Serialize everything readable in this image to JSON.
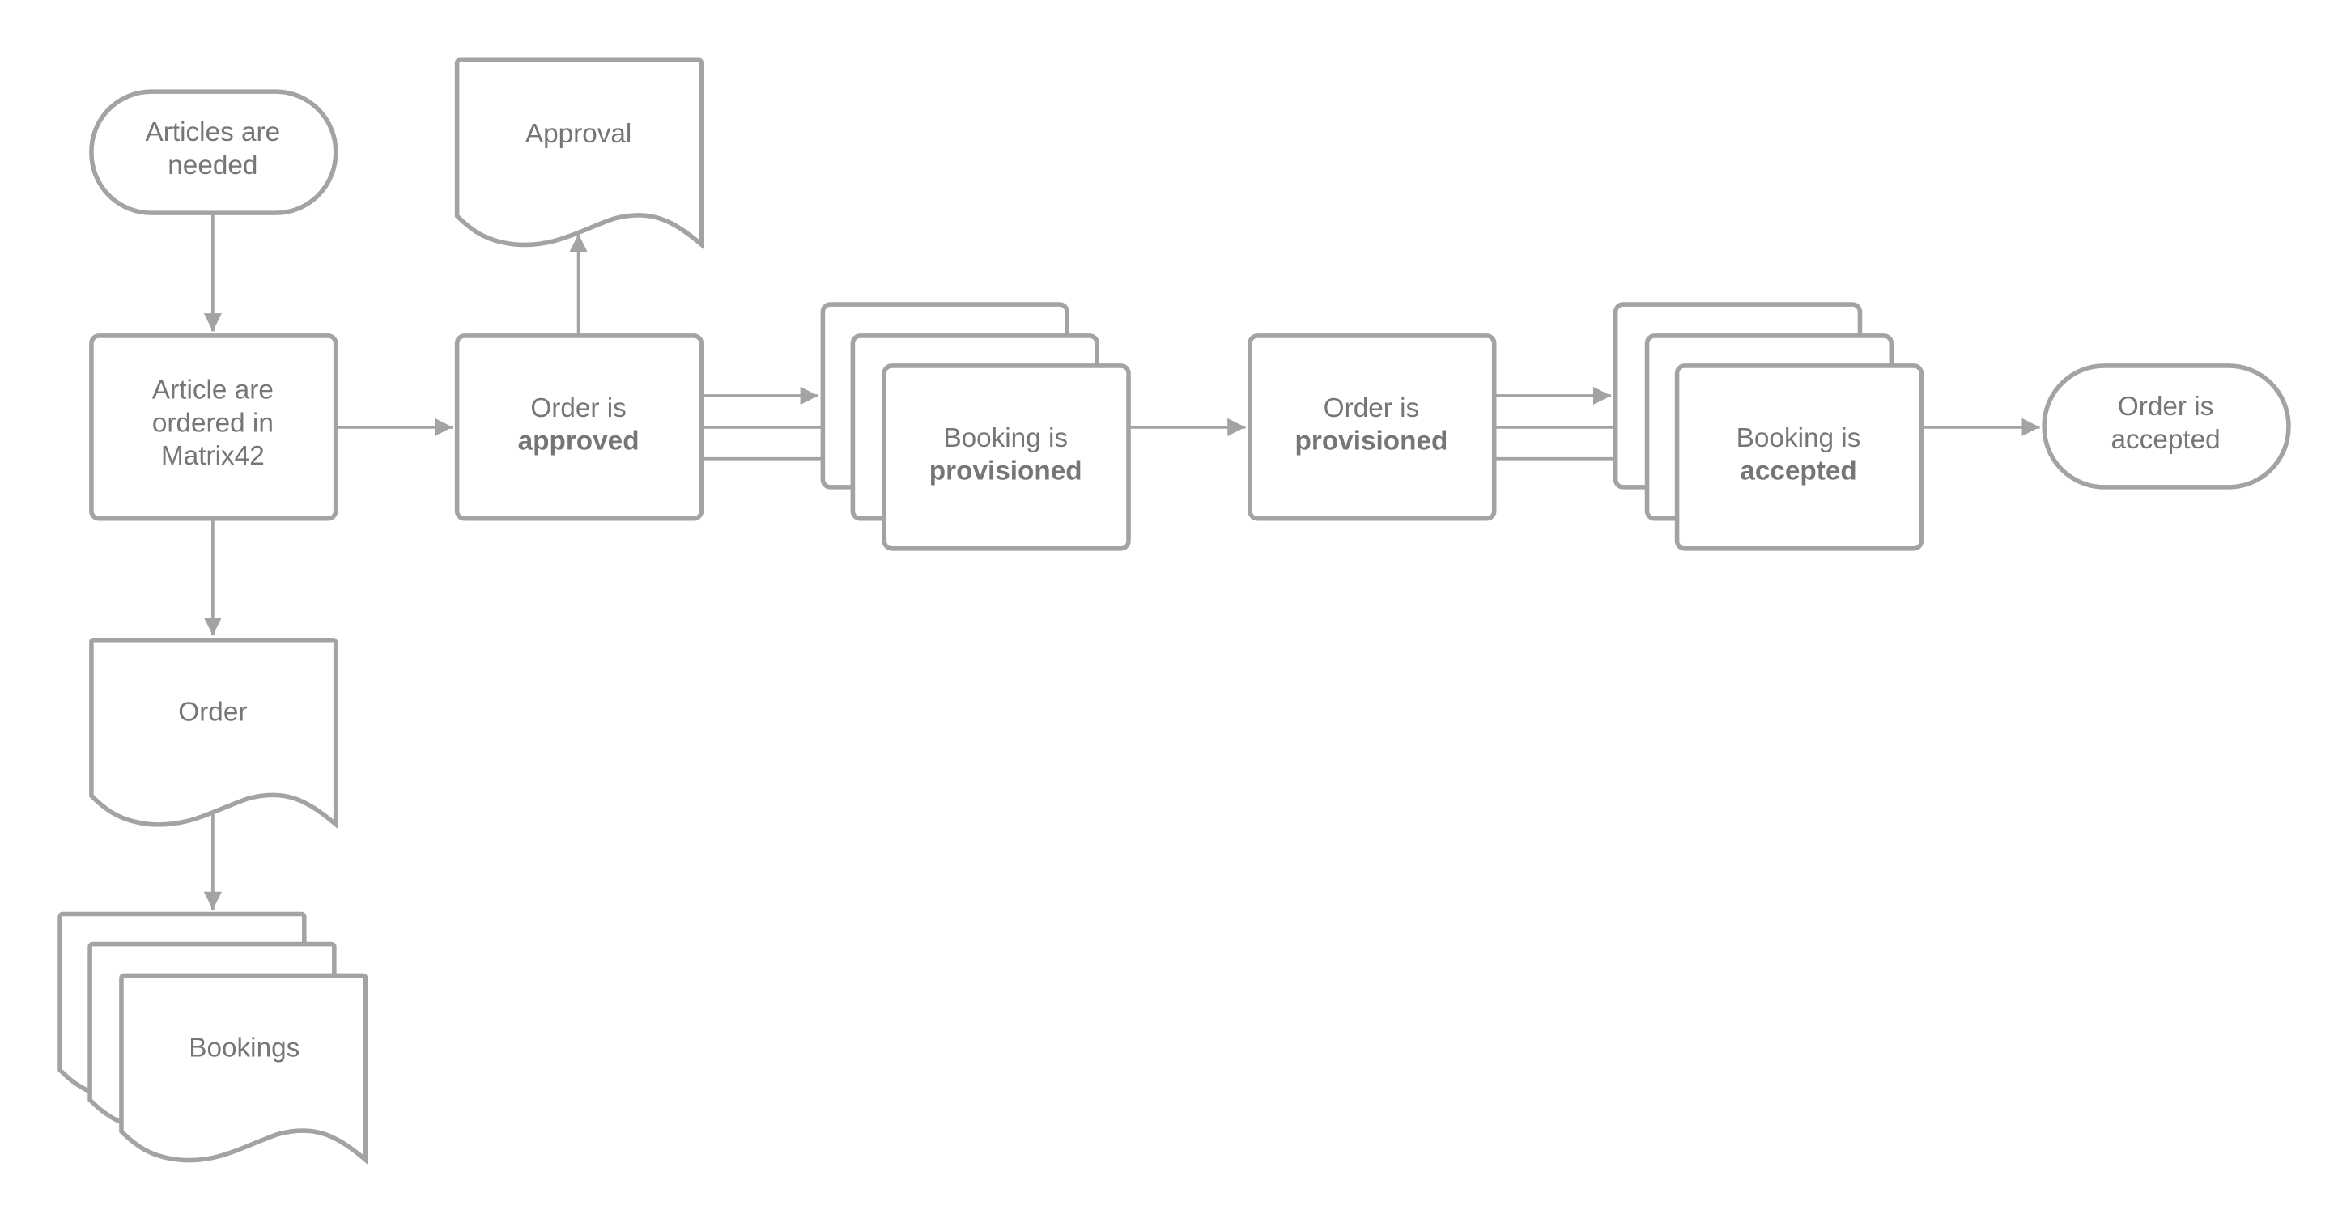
{
  "diagram": {
    "colors": {
      "stroke": "#a3a3a3",
      "text": "#767676",
      "background": "#ffffff"
    },
    "nodes": {
      "start": {
        "type": "terminator",
        "lines": [
          "Articles are",
          "needed"
        ]
      },
      "ordered": {
        "type": "process",
        "lines": [
          "Article are",
          "ordered in",
          "Matrix42"
        ]
      },
      "order_doc": {
        "type": "document",
        "lines": [
          "Order"
        ]
      },
      "bookings_doc": {
        "type": "multi-document",
        "lines": [
          "Bookings"
        ]
      },
      "approval_doc": {
        "type": "document",
        "lines": [
          "Approval"
        ]
      },
      "approved": {
        "type": "process",
        "line1": "Order is",
        "line2_bold": "approved"
      },
      "booking_provisioned": {
        "type": "multi-process",
        "line1": "Booking is",
        "line2_bold": "provisioned"
      },
      "order_provisioned": {
        "type": "process",
        "line1": "Order is",
        "line2_bold": "provisioned"
      },
      "booking_accepted": {
        "type": "multi-process",
        "line1": "Booking is",
        "line2_bold": "accepted"
      },
      "end": {
        "type": "terminator",
        "lines": [
          "Order is",
          "accepted"
        ]
      }
    },
    "edges": [
      [
        "start",
        "ordered"
      ],
      [
        "ordered",
        "order_doc"
      ],
      [
        "order_doc",
        "bookings_doc"
      ],
      [
        "ordered",
        "approved"
      ],
      [
        "approved",
        "approval_doc"
      ],
      [
        "approved",
        "booking_provisioned"
      ],
      [
        "booking_provisioned",
        "order_provisioned"
      ],
      [
        "order_provisioned",
        "booking_accepted"
      ],
      [
        "booking_accepted",
        "end"
      ]
    ]
  }
}
